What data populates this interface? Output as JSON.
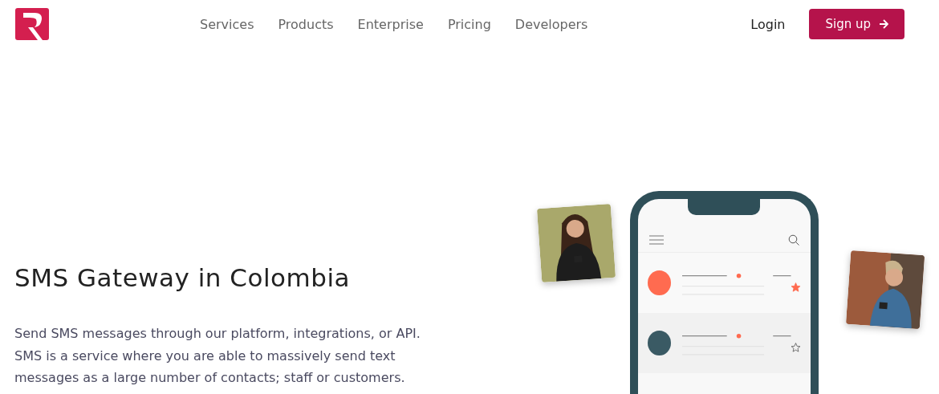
{
  "nav": {
    "links": [
      {
        "label": "Services"
      },
      {
        "label": "Products"
      },
      {
        "label": "Enterprise"
      },
      {
        "label": "Pricing"
      },
      {
        "label": "Developers"
      }
    ],
    "login": "Login",
    "signup": "Sign up"
  },
  "hero": {
    "title": "SMS Gateway in Colombia",
    "description": "Send SMS messages through our platform, integrations, or API. SMS is a service where you are able to massively send text messages as a large number of contacts; staff or customers."
  },
  "illustration": {
    "messages": [
      {
        "color": "#ff6b50",
        "starred": true
      },
      {
        "color": "#3a5a64",
        "starred": false
      }
    ]
  }
}
